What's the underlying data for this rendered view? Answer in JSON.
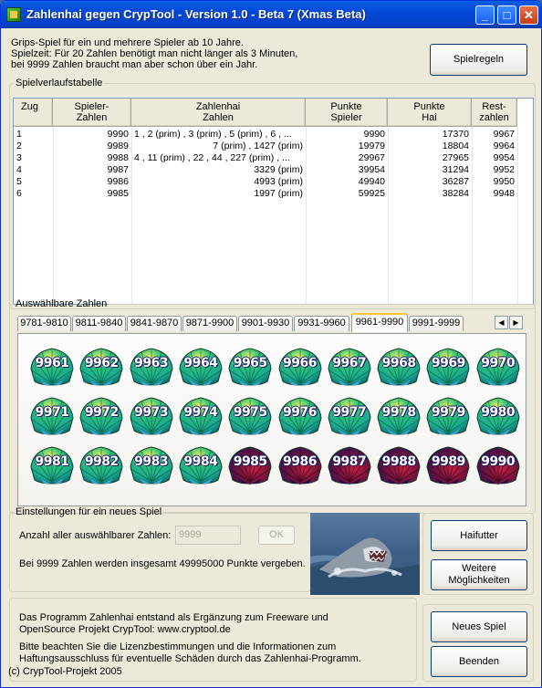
{
  "window": {
    "title": "Zahlenhai gegen CrypTool - Version 1.0 - Beta 7 (Xmas Beta)"
  },
  "intro": {
    "line1": "Grips-Spiel für ein und mehrere Spieler ab 10 Jahre.",
    "line2": "Spielzeit: Für 20 Zahlen benötigt man nicht länger als 3 Minuten,",
    "line3": "bei 9999 Zahlen braucht man aber schon über ein Jahr."
  },
  "buttons": {
    "rules": "Spielregeln",
    "haifutter": "Haifutter",
    "weitere1": "Weitere",
    "weitere2": "Möglichkeiten",
    "neues_spiel": "Neues Spiel",
    "beenden": "Beenden",
    "ok": "OK"
  },
  "history": {
    "legend": "Spielverlaufstabelle",
    "headers": [
      {
        "l1": "Zug",
        "l2": ""
      },
      {
        "l1": "Spieler-",
        "l2": "Zahlen"
      },
      {
        "l1": "Zahlenhai",
        "l2": "Zahlen"
      },
      {
        "l1": "Punkte",
        "l2": "Spieler"
      },
      {
        "l1": "Punkte",
        "l2": "Hai"
      },
      {
        "l1": "Rest-",
        "l2": "zahlen"
      }
    ],
    "rows": [
      [
        "1",
        "9990",
        "1 , 2 (prim) , 3 (prim) , 5 (prim) , 6 , ...",
        "9990",
        "17370",
        "9967"
      ],
      [
        "2",
        "9989",
        "7 (prim) , 1427 (prim)",
        "19979",
        "18804",
        "9964"
      ],
      [
        "3",
        "9988",
        "4 , 11 (prim) , 22 , 44 , 227 (prim) , ...",
        "29967",
        "27965",
        "9954"
      ],
      [
        "4",
        "9987",
        "3329 (prim)",
        "39954",
        "31294",
        "9952"
      ],
      [
        "5",
        "9986",
        "4993 (prim)",
        "49940",
        "36287",
        "9950"
      ],
      [
        "6",
        "9985",
        "1997 (prim)",
        "59925",
        "38284",
        "9948"
      ]
    ]
  },
  "selectable": {
    "legend": "Auswählbare Zahlen",
    "tabs": [
      "9781-9810",
      "9811-9840",
      "9841-9870",
      "9871-9900",
      "9901-9930",
      "9931-9960",
      "9961-9990",
      "9991-9999"
    ],
    "selected_tab": "9961-9990",
    "numbers": [
      "9961",
      "9962",
      "9963",
      "9964",
      "9965",
      "9966",
      "9967",
      "9968",
      "9969",
      "9970",
      "9971",
      "9972",
      "9973",
      "9974",
      "9975",
      "9976",
      "9977",
      "9978",
      "9979",
      "9980",
      "9981",
      "9982",
      "9983",
      "9984",
      "9985",
      "9986",
      "9987",
      "9988",
      "9989",
      "9990"
    ],
    "taken": [
      "9985",
      "9986",
      "9987",
      "9988",
      "9989",
      "9990"
    ],
    "colors": {
      "available": "#2bc07a",
      "taken": "#7a1438"
    }
  },
  "settings": {
    "legend": "Einstellungen für ein neues Spiel",
    "count_label": "Anzahl aller auswählbarer Zahlen:",
    "count_value": "9999",
    "info": "Bei 9999 Zahlen werden insgesamt 49995000 Punkte vergeben."
  },
  "footer": {
    "line1": "Das Programm Zahlenhai entstand als Ergänzung zum Freeware und",
    "line2": "OpenSource Projekt CrypTool: www.cryptool.de",
    "line3": "Bitte beachten Sie die Lizenzbestimmungen und die Informationen zum",
    "line4": "Haftungsausschluss für eventuelle Schäden durch das Zahlenhai-Programm.",
    "line5": "(c) CrypTool-Projekt 2005"
  }
}
